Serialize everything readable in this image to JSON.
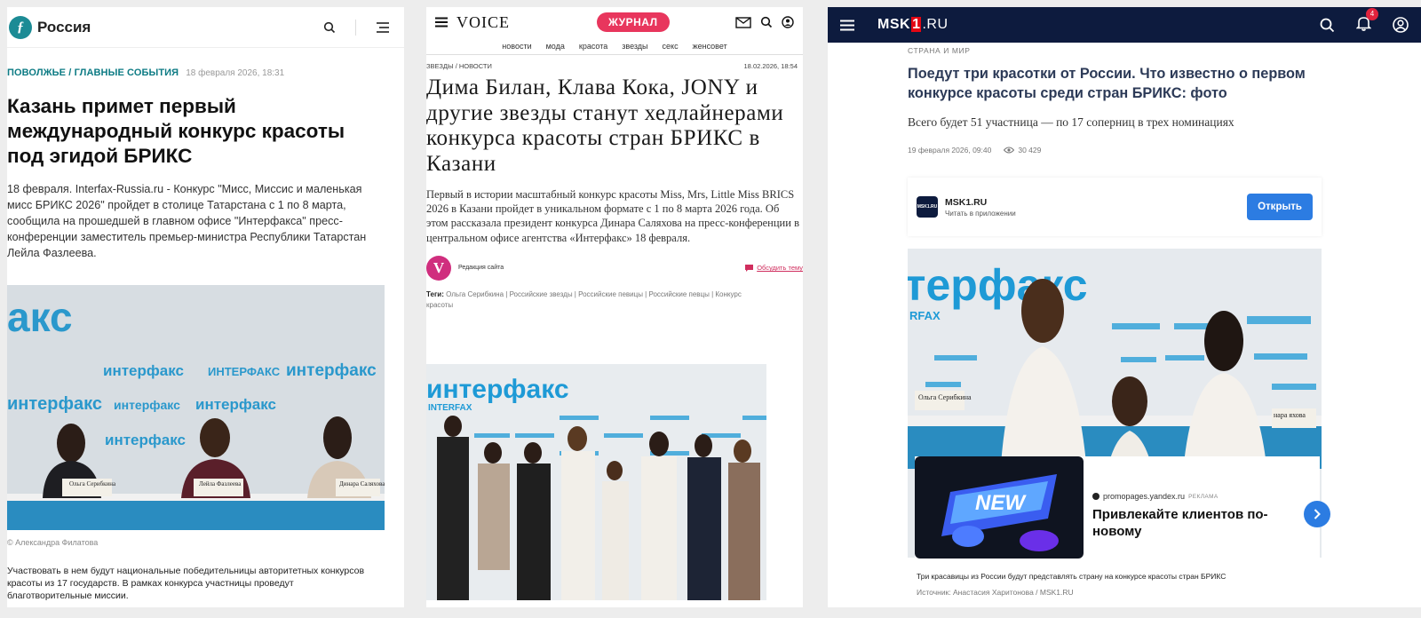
{
  "panel1": {
    "brand": "Россия",
    "category": "ПОВОЛЖЬЕ / ГЛАВНЫЕ СОБЫТИЯ",
    "date": "18 февраля 2026, 18:31",
    "title": "Казань примет первый международный конкурс красоты под эгидой БРИКС",
    "lead": "18 февраля. Interfax-Russia.ru - Конкурс \"Мисс, Миссис и маленькая мисс БРИКС 2026\" пройдет в столице  Татарстана с 1 по 8 марта, сообщила на прошедшей в главном офисе \"Интерфакса\" пресс-конференции заместитель премьер-министра Республики Татарстан Лейла Фазлеева.",
    "photo_logo": "акс",
    "photo_wall": [
      "интерфакс",
      "ИНТЕРФАКС",
      "интерфакс",
      "интерфакс",
      "интерфакс",
      "интерфакс",
      "интерфакс"
    ],
    "nameplates": [
      "Ольга Серибкина",
      "Лейла Фазлеева",
      "Динара Саляхова"
    ],
    "credit": "© Александра Филатова",
    "body": "Участвовать в нем будут национальные победительницы авторитетных конкурсов красоты из 17 государств. В рамках конкурса участницы проведут благотворительные миссии."
  },
  "panel2": {
    "logo": "VOICE",
    "pill": "ЖУРНАЛ",
    "nav": [
      "новости",
      "мода",
      "красота",
      "звезды",
      "секс",
      "женсовет"
    ],
    "category": "ЗВЕЗДЫ / НОВОСТИ",
    "date": "18.02.2026, 18:54",
    "title": "Дима Билан, Клава Кока, JONY и другие звезды станут хедлайнерами конкурса красоты стран БРИКС в Казани",
    "lead": "Первый в истории масштабный конкурс красоты Miss, Mrs, Little Miss BRICS 2026 в Казани пройдет в уникальном формате с 1 по 8 марта 2026 года. Об этом рассказала президент конкурса Динара Саляхова на пресс-конференции в центральном офисе агентства «Интерфакс» 18 февраля.",
    "avatar_letter": "V",
    "author": "Редакция сайта",
    "discuss": "Обсудить тему",
    "tags_label": "Теги:",
    "tags": "Ольга Серибкина | Российские звезды | Российские певицы | Российские певцы | Конкурс красоты",
    "photo_logo": "интерфакс",
    "photo_sub": "INTERFAX"
  },
  "panel3": {
    "logo_a": "MSK",
    "logo_b": "1",
    "logo_c": ".RU",
    "badge": "4",
    "category": "СТРАНА И МИР",
    "title": "Поедут три красотки от России. Что известно о первом конкурсе красоты среди стран БРИКС: фото",
    "lead": "Всего будет 51 участница — по 17 соперниц в трех номинациях",
    "date": "19 февраля 2026, 09:40",
    "views": "30 429",
    "app_icon_text": "MSK1.RU",
    "app_name": "MSK1.RU",
    "app_sub": "Читать в приложении",
    "open_button": "Открыть",
    "photo_logo": "терфакс",
    "photo_sub": "RFAX",
    "nameplates": [
      "Ольга Серибкина",
      "нара яхова"
    ],
    "ad_badge": "NEW",
    "ad_source": "promopages.yandex.ru",
    "ad_label": "РЕКЛАМА",
    "ad_title": "Привлекайте клиентов по-новому",
    "caption": "Три красавицы из России будут представлять страну на конкурсе красоты стран БРИКС",
    "source": "Источник: Анастасия Харитонова / MSK1.RU"
  }
}
